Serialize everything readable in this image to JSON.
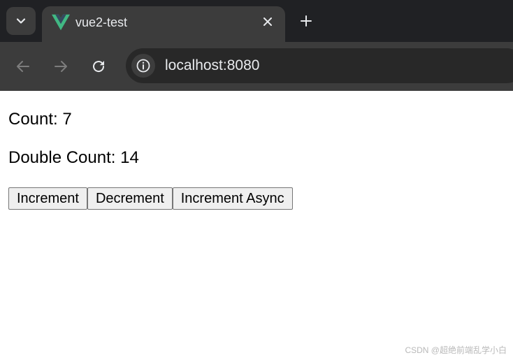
{
  "browser": {
    "tab": {
      "title": "vue2-test",
      "favicon": "vue-logo-icon"
    },
    "address_bar": {
      "url": "localhost:8080"
    },
    "icons": {
      "tab_search": "chevron-down-icon",
      "close": "close-icon",
      "new_tab": "plus-icon",
      "back": "arrow-left-icon",
      "forward": "arrow-right-icon",
      "reload": "reload-icon",
      "site_info": "info-icon"
    },
    "colors": {
      "tabstrip_bg": "#202124",
      "toolbar_bg": "#3c3c3c",
      "vue_green": "#41b883",
      "vue_dark": "#35495e"
    }
  },
  "app": {
    "count_text": "Count: 7",
    "double_count_text": "Double Count: 14",
    "buttons": {
      "increment": "Increment",
      "decrement": "Decrement",
      "increment_async": "Increment Async"
    }
  },
  "watermark": "CSDN @超绝前端乱学小白"
}
